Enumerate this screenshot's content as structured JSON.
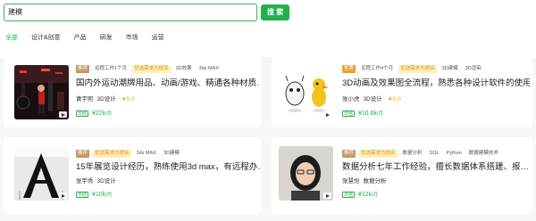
{
  "search": {
    "value": "建模",
    "button_label": "搜 索"
  },
  "categories": [
    {
      "label": "全部",
      "active": true
    },
    {
      "label": "设计&创意",
      "active": false
    },
    {
      "label": "产品",
      "active": false
    },
    {
      "label": "研发",
      "active": false
    },
    {
      "label": "市场",
      "active": false
    },
    {
      "label": "运营",
      "active": false
    }
  ],
  "cards": [
    {
      "badge": "推荐",
      "tags": [
        "远程工作1个月",
        "优选需求方提名",
        "3D效果",
        "3ds MAX"
      ],
      "title": "国内外运动潮牌用品、动画/游戏、精通各种材质…",
      "name": "黄宇熙",
      "skill": "3D设计",
      "rating": "★5.0",
      "pay_label": "日结",
      "price": "¥22k",
      "price_unit": "/月"
    },
    {
      "badge": "优秀",
      "tags": [
        "远程工作4个月",
        "优选需求方提名",
        "3D建模",
        "3D渲染"
      ],
      "title": "3D动画及效果图全流程，熟悉各种设计软件的使用",
      "name": "张小虎",
      "skill": "3D设计",
      "rating": "★5.0",
      "pay_label": "日结",
      "price": "¥16.6k",
      "price_unit": "/月"
    },
    {
      "badge": "推荐",
      "tags": [
        "优选需求方提名",
        "3ds MAX",
        "3D建模"
      ],
      "title": "15年展览设计经历，熟练使用3d max，有远程办…",
      "name": "张宇秀",
      "skill": "3D设计",
      "rating": "",
      "pay_label": "日结",
      "price": "¥10k",
      "price_unit": "/月"
    },
    {
      "badge": "推荐",
      "tags": [
        "优选需求方提名",
        "数据分析",
        "SQL",
        "Python",
        "数据建模技术"
      ],
      "title": "数据分析七年工作经验，擅长数据体系搭建、报…",
      "name": "张慧怡",
      "skill": "数据分析",
      "rating": "",
      "pay_label": "日结",
      "price": "¥12k",
      "price_unit": "/月"
    }
  ],
  "colors": {
    "accent": "#23b14d",
    "badge_recommend": "#c79a63",
    "badge_excellent": "#e7a13b",
    "star": "#f5a623"
  }
}
